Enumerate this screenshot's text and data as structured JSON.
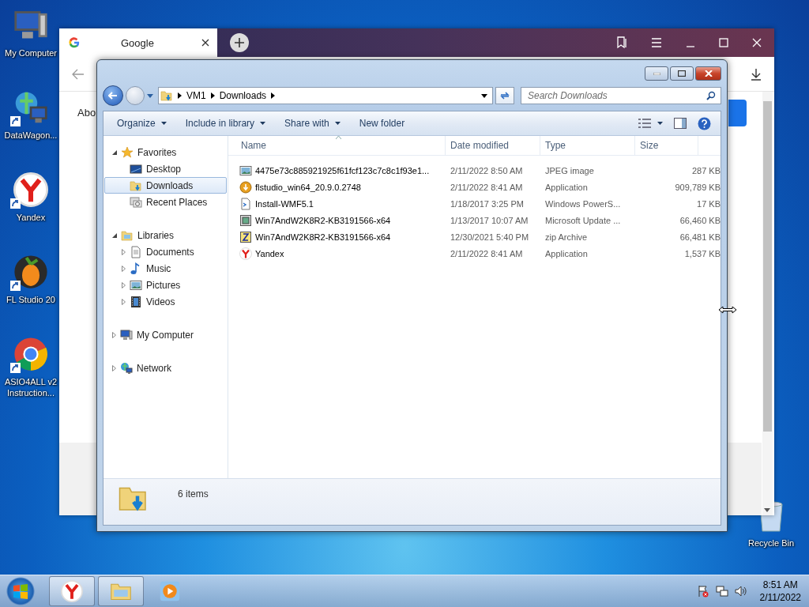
{
  "desktop": {
    "icons": [
      {
        "label": "My Computer",
        "kind": "computer",
        "shortcut": false
      },
      {
        "label": "DataWagon...",
        "kind": "network",
        "shortcut": true
      },
      {
        "label": "Yandex",
        "kind": "yandex",
        "shortcut": true
      },
      {
        "label": "FL Studio 20",
        "kind": "fruit",
        "shortcut": true
      },
      {
        "label": "ASIO4ALL v2 Instruction...",
        "kind": "chrome",
        "shortcut": true
      }
    ],
    "recycle_bin": {
      "label": "Recycle Bin"
    }
  },
  "browser": {
    "tab": {
      "title": "Google"
    },
    "content_text": "Abo"
  },
  "explorer": {
    "breadcrumb": [
      "VM1",
      "Downloads"
    ],
    "search": {
      "placeholder": "Search Downloads"
    },
    "commands": [
      {
        "label": "Organize",
        "dropdown": true
      },
      {
        "label": "Include in library",
        "dropdown": true
      },
      {
        "label": "Share with",
        "dropdown": true
      },
      {
        "label": "New folder",
        "dropdown": false
      }
    ],
    "navigation": [
      {
        "label": "Favorites",
        "kind": "star",
        "expanded": true,
        "children": [
          {
            "label": "Desktop",
            "kind": "desktop",
            "selected": false
          },
          {
            "label": "Downloads",
            "kind": "downloads",
            "selected": true
          },
          {
            "label": "Recent Places",
            "kind": "recent",
            "selected": false
          }
        ]
      },
      {
        "label": "Libraries",
        "kind": "library",
        "expanded": true,
        "children": [
          {
            "label": "Documents",
            "kind": "document",
            "selected": false,
            "expanded": false
          },
          {
            "label": "Music",
            "kind": "music",
            "selected": false,
            "expanded": false
          },
          {
            "label": "Pictures",
            "kind": "picture",
            "selected": false,
            "expanded": false
          },
          {
            "label": "Videos",
            "kind": "video",
            "selected": false,
            "expanded": false
          }
        ]
      },
      {
        "label": "My Computer",
        "kind": "computer",
        "expanded": false
      },
      {
        "label": "Network",
        "kind": "network",
        "expanded": false
      }
    ],
    "columns": [
      {
        "label": "Name",
        "sorted": true
      },
      {
        "label": "Date modified",
        "sorted": false
      },
      {
        "label": "Type",
        "sorted": false
      },
      {
        "label": "Size",
        "sorted": false
      }
    ],
    "files": [
      {
        "name": "4475e73c885921925f61fcf123c7c8c1f93e1...",
        "date": "2/11/2022 8:50 AM",
        "type": "JPEG image",
        "size": "287 KB",
        "kind": "image"
      },
      {
        "name": "flstudio_win64_20.9.0.2748",
        "date": "2/11/2022 8:41 AM",
        "type": "Application",
        "size": "909,789 KB",
        "kind": "installer"
      },
      {
        "name": "Install-WMF5.1",
        "date": "1/18/2017 3:25 PM",
        "type": "Windows PowerS...",
        "size": "17 KB",
        "kind": "script"
      },
      {
        "name": "Win7AndW2K8R2-KB3191566-x64",
        "date": "1/13/2017 10:07 AM",
        "type": "Microsoft Update ...",
        "size": "66,460 KB",
        "kind": "update"
      },
      {
        "name": "Win7AndW2K8R2-KB3191566-x64",
        "date": "12/30/2021 5:40 PM",
        "type": "zip Archive",
        "size": "66,481 KB",
        "kind": "zip"
      },
      {
        "name": "Yandex",
        "date": "2/11/2022 8:41 AM",
        "type": "Application",
        "size": "1,537 KB",
        "kind": "yandex"
      }
    ],
    "status": {
      "count": "6 items"
    }
  },
  "taskbar": {
    "buttons": [
      {
        "kind": "yandex",
        "running": true
      },
      {
        "kind": "explorer",
        "running": true
      },
      {
        "kind": "media",
        "running": false
      }
    ],
    "clock": {
      "time": "8:51 AM",
      "date": "2/11/2022"
    }
  }
}
